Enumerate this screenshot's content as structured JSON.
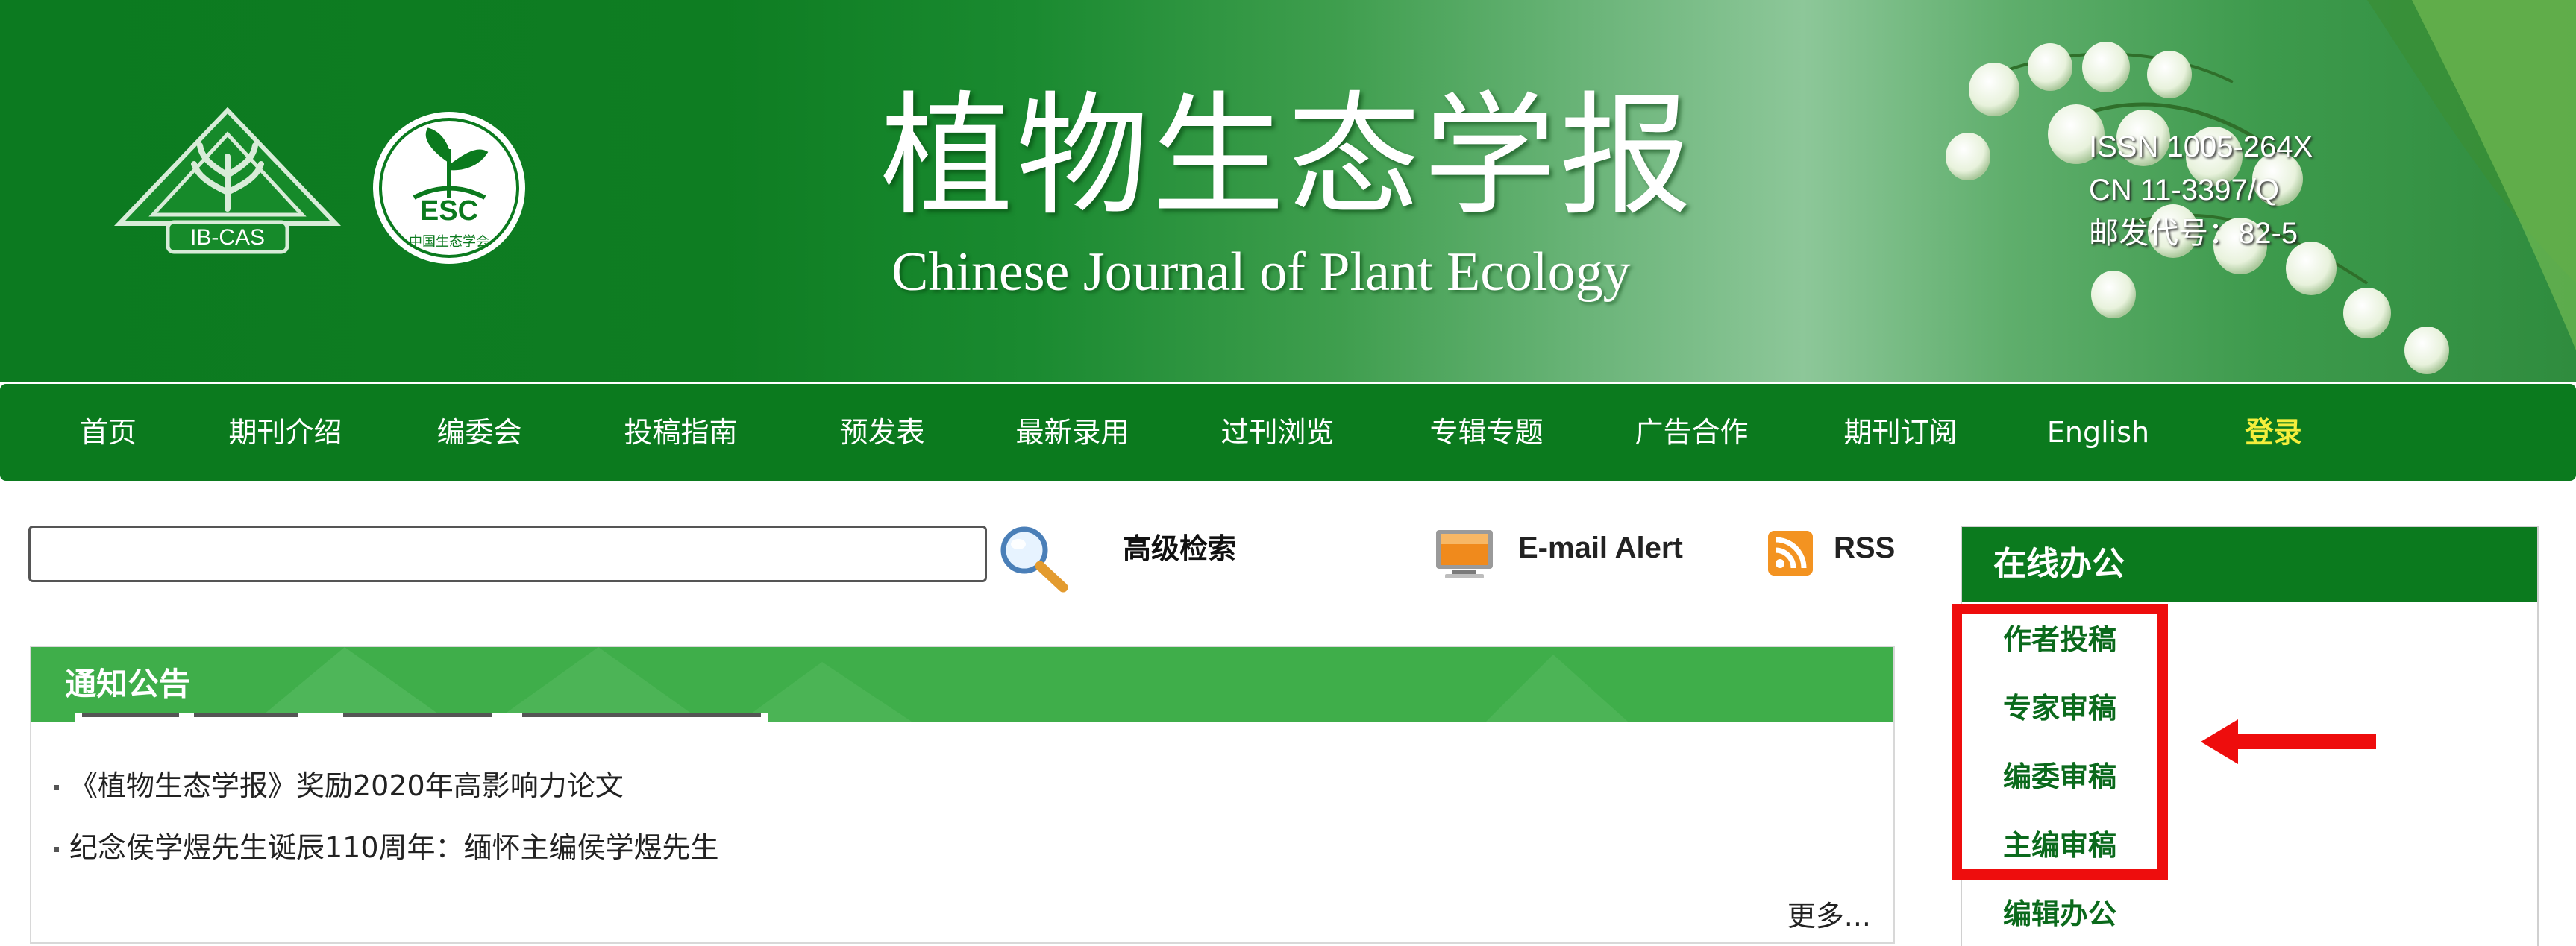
{
  "banner": {
    "title_zh": "植物生态学报",
    "title_en": "Chinese Journal of Plant Ecology",
    "logo_left_text": "IB-CAS",
    "logo_right_text": "中国生态学会",
    "logo_right_mark": "ESC",
    "issn": "ISSN 1005-264X",
    "cn": "CN 11-3397/Q",
    "postal_code": "邮发代号：82-5"
  },
  "nav": {
    "items": [
      {
        "label": "首页"
      },
      {
        "label": "期刊介绍"
      },
      {
        "label": "编委会"
      },
      {
        "label": "投稿指南"
      },
      {
        "label": "预发表"
      },
      {
        "label": "最新录用"
      },
      {
        "label": "过刊浏览"
      },
      {
        "label": "专辑专题"
      },
      {
        "label": "广告合作"
      },
      {
        "label": "期刊订阅"
      },
      {
        "label": "English"
      },
      {
        "label": "登录",
        "highlight": true
      }
    ]
  },
  "search": {
    "value": "",
    "advanced_label": "高级检索",
    "email_alert_label": "E-mail Alert",
    "rss_label": "RSS"
  },
  "notices": {
    "title": "通知公告",
    "items": [
      {
        "text": "《植物生态学报》奖励2020年高影响力论文"
      },
      {
        "text": "纪念侯学煜先生诞辰110周年：缅怀主编侯学煜先生"
      }
    ],
    "more_label": "更多..."
  },
  "office": {
    "title": "在线办公",
    "links": [
      {
        "label": "作者投稿"
      },
      {
        "label": "专家审稿"
      },
      {
        "label": "编委审稿"
      },
      {
        "label": "主编审稿"
      },
      {
        "label": "编辑办公"
      }
    ]
  },
  "colors": {
    "nav_bg": "#0b7a1e",
    "notice_header_bg": "#3fae4a",
    "login_text": "#f4ee3c",
    "highlight_red": "#ee0d0d"
  },
  "icons": {
    "search": "magnifier-icon",
    "email_alert": "monitor-icon",
    "rss": "rss-icon"
  }
}
